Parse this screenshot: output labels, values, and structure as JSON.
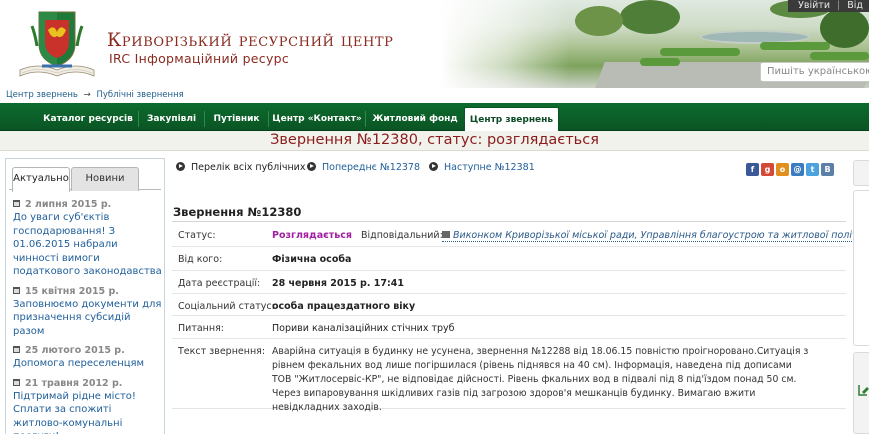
{
  "header": {
    "title": "Криворізький ресурсний центр",
    "subtitle": "IRC Інформаційний ресурс",
    "top_links": [
      "Увійти",
      "|",
      "Від"
    ],
    "search_placeholder": "Пишіть українською мовою"
  },
  "breadcrumb": {
    "items": [
      "Центр звернень",
      "Публічні звернення"
    ],
    "separator": "→"
  },
  "nav": {
    "items": [
      {
        "label": "Каталог ресурсів"
      },
      {
        "label": "Закупівлі"
      },
      {
        "label": "Путівник"
      },
      {
        "label": "Центр «Контакт»"
      },
      {
        "label": "Житловий фонд"
      },
      {
        "label": "Центр звернень",
        "active": true
      }
    ]
  },
  "page_title": "Звернення №12380, статус: розглядається",
  "sidebar": {
    "tabs": [
      {
        "label": "Актуально",
        "active": true
      },
      {
        "label": "Новини",
        "active": false
      }
    ],
    "news": [
      {
        "date": "2 липня 2015 р.",
        "text": "До уваги суб'єктів господарювання! З 01.06.2015 набрали чинності вимоги податкового законодавства"
      },
      {
        "date": "15 квітня 2015 р.",
        "text": "Заповнюємо документи для призначення субсидій разом"
      },
      {
        "date": "25 лютого 2015 р.",
        "text": "Допомога переселенцям"
      },
      {
        "date": "21 травня 2012 р.",
        "text": "Підтримай рідне місто! Сплати за спожиті житлово-комунальні послуги!"
      }
    ]
  },
  "pager": {
    "all_public": "Перелік всіх публічних",
    "prev": "Попереднє №12378",
    "next": "Наступне №12381"
  },
  "share_icons": [
    {
      "name": "facebook-icon",
      "glyph": "f",
      "color": "#3b5998"
    },
    {
      "name": "google-plus-icon",
      "glyph": "g",
      "color": "#d34836"
    },
    {
      "name": "odnoklassniki-icon",
      "glyph": "o",
      "color": "#e38f1e"
    },
    {
      "name": "mailru-icon",
      "glyph": "@",
      "color": "#3b7bbf"
    },
    {
      "name": "twitter-icon",
      "glyph": "t",
      "color": "#4aa3df"
    },
    {
      "name": "vkontakte-icon",
      "glyph": "B",
      "color": "#5b7fa6"
    }
  ],
  "appeal": {
    "title": "Звернення №12380",
    "status_label": "Статус:",
    "status_value": "Розглядається",
    "responsible_label": "Відповідальний:",
    "responsible_value": "Виконком Криворізької міської ради, Управління благоустрою та житлової політики",
    "from_label": "Від кого:",
    "from_value": "Фізична особа",
    "date_label": "Дата реєстрації:",
    "date_value": "28 червня 2015 р. 17:41",
    "social_label": "Соціальний статус:",
    "social_value": "особа працездатного віку",
    "question_label": "Питання:",
    "question_value": "Пориви каналізаційних стічних труб",
    "text_label": "Текст звернення:",
    "text_value": "Аварійна ситуація в будинку не усунена, звернення №12288 від 18.06.15 повністю проігноровано.Ситуація з рівнем фекальних вод лише погіршилася (рівень піднявся на 40 см). Інформація, наведена під дописами ТОВ \"Житлосервіс-КР\", не відповідає дійсності. Рівень фкальних вод в підвалі під 8 під'їздом понад 50 см. Через випаровування шкідливих газів під загрозою здоров'я мешканців будинку. Вимагаю вжити невідкладних заходів."
  },
  "colors": {
    "nav_green": "#0d6b2e",
    "title_red": "#8a1c1c",
    "status_purple": "#a11ea1",
    "link_blue": "#1f5e9a"
  }
}
